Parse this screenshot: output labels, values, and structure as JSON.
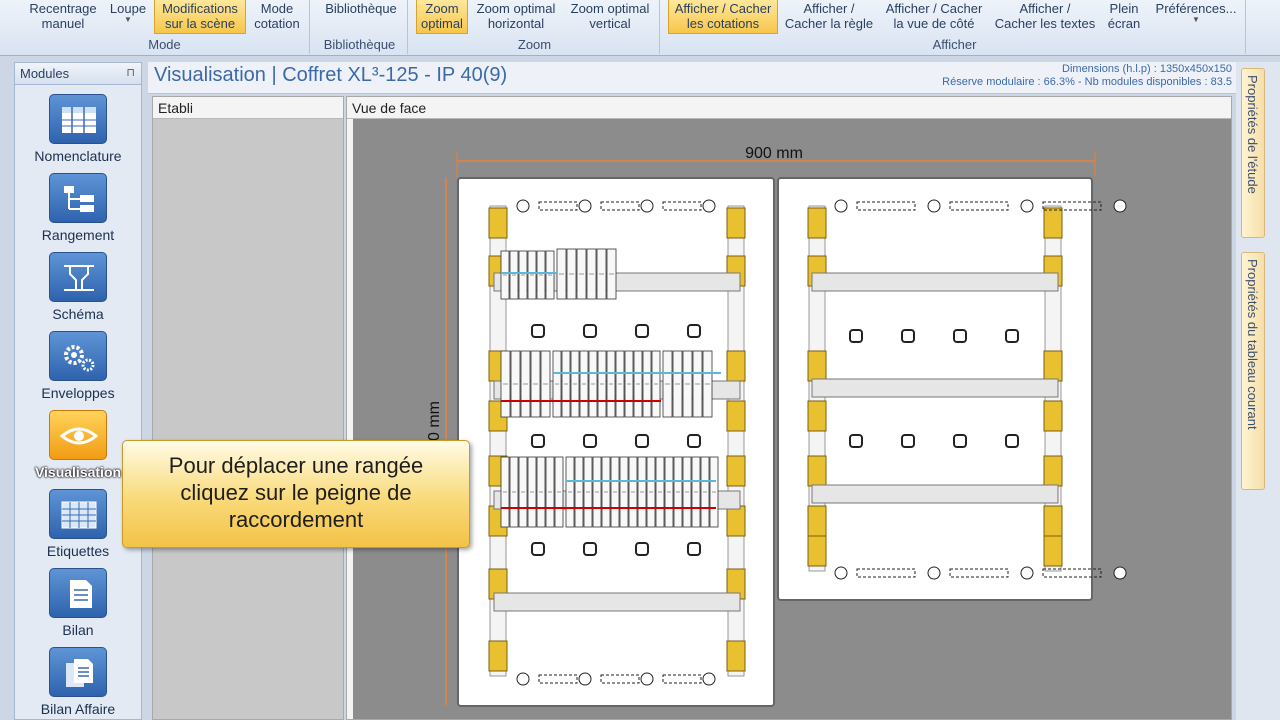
{
  "ribbon": {
    "mode_group": {
      "label": "Mode",
      "buttons": [
        {
          "line1": "Recentrage",
          "line2": "manuel"
        },
        {
          "line1": "Loupe",
          "line2": ""
        },
        {
          "line1": "Modifications",
          "line2": "sur la scène"
        },
        {
          "line1": "Mode",
          "line2": "cotation"
        }
      ]
    },
    "bibliotheque_group": {
      "label": "Bibliothèque",
      "button": {
        "line1": "Bibliothèque"
      }
    },
    "zoom_group": {
      "label": "Zoom",
      "buttons": [
        {
          "line1": "Zoom",
          "line2": "optimal"
        },
        {
          "line1": "Zoom optimal",
          "line2": "horizontal"
        },
        {
          "line1": "Zoom optimal",
          "line2": "vertical"
        }
      ]
    },
    "afficher_group": {
      "label": "Afficher",
      "buttons": [
        {
          "line1": "Afficher / Cacher",
          "line2": "les cotations"
        },
        {
          "line1": "Afficher /",
          "line2": "Cacher la règle"
        },
        {
          "line1": "Afficher / Cacher",
          "line2": "la vue de côté"
        },
        {
          "line1": "Afficher /",
          "line2": "Cacher les textes"
        },
        {
          "line1": "Plein",
          "line2": "écran"
        },
        {
          "line1": "Préférences...",
          "line2": ""
        }
      ]
    }
  },
  "modules": {
    "header": "Modules",
    "items": [
      {
        "label": "Nomenclature",
        "icon": "nomenclature-icon"
      },
      {
        "label": "Rangement",
        "icon": "rangement-icon"
      },
      {
        "label": "Schéma",
        "icon": "schema-icon"
      },
      {
        "label": "Enveloppes",
        "icon": "gears-icon"
      },
      {
        "label": "Visualisation",
        "icon": "eye-icon"
      },
      {
        "label": "Etiquettes",
        "icon": "table-icon"
      },
      {
        "label": "Bilan",
        "icon": "document-icon"
      },
      {
        "label": "Bilan Affaire",
        "icon": "documents-icon"
      }
    ]
  },
  "view": {
    "title": "Visualisation | Coffret XL³-125 - IP 40(9)",
    "dimensions": "Dimensions (h.l.p) : 1350x450x150",
    "reserve": "Réserve modulaire : 66.3% - Nb modules disponibles : 83.5"
  },
  "panels": {
    "etabli": "Etabli",
    "vue_de_face": "Vue de face"
  },
  "drawing": {
    "width_label": "900 mm",
    "height_label": "0 mm"
  },
  "side_tabs": {
    "etude": "Propriétés de l'étude",
    "tableau": "Propriétés du tableau courant"
  },
  "tooltip": {
    "line1": "Pour déplacer une rangée",
    "line2": "cliquez sur le peigne de",
    "line3": "raccordement"
  },
  "colors": {
    "accent_orange": "#f29c14",
    "dimension_line": "#e8823a",
    "rail_yellow": "#e8c030",
    "ribbon_blue": "#3c6aa8"
  }
}
